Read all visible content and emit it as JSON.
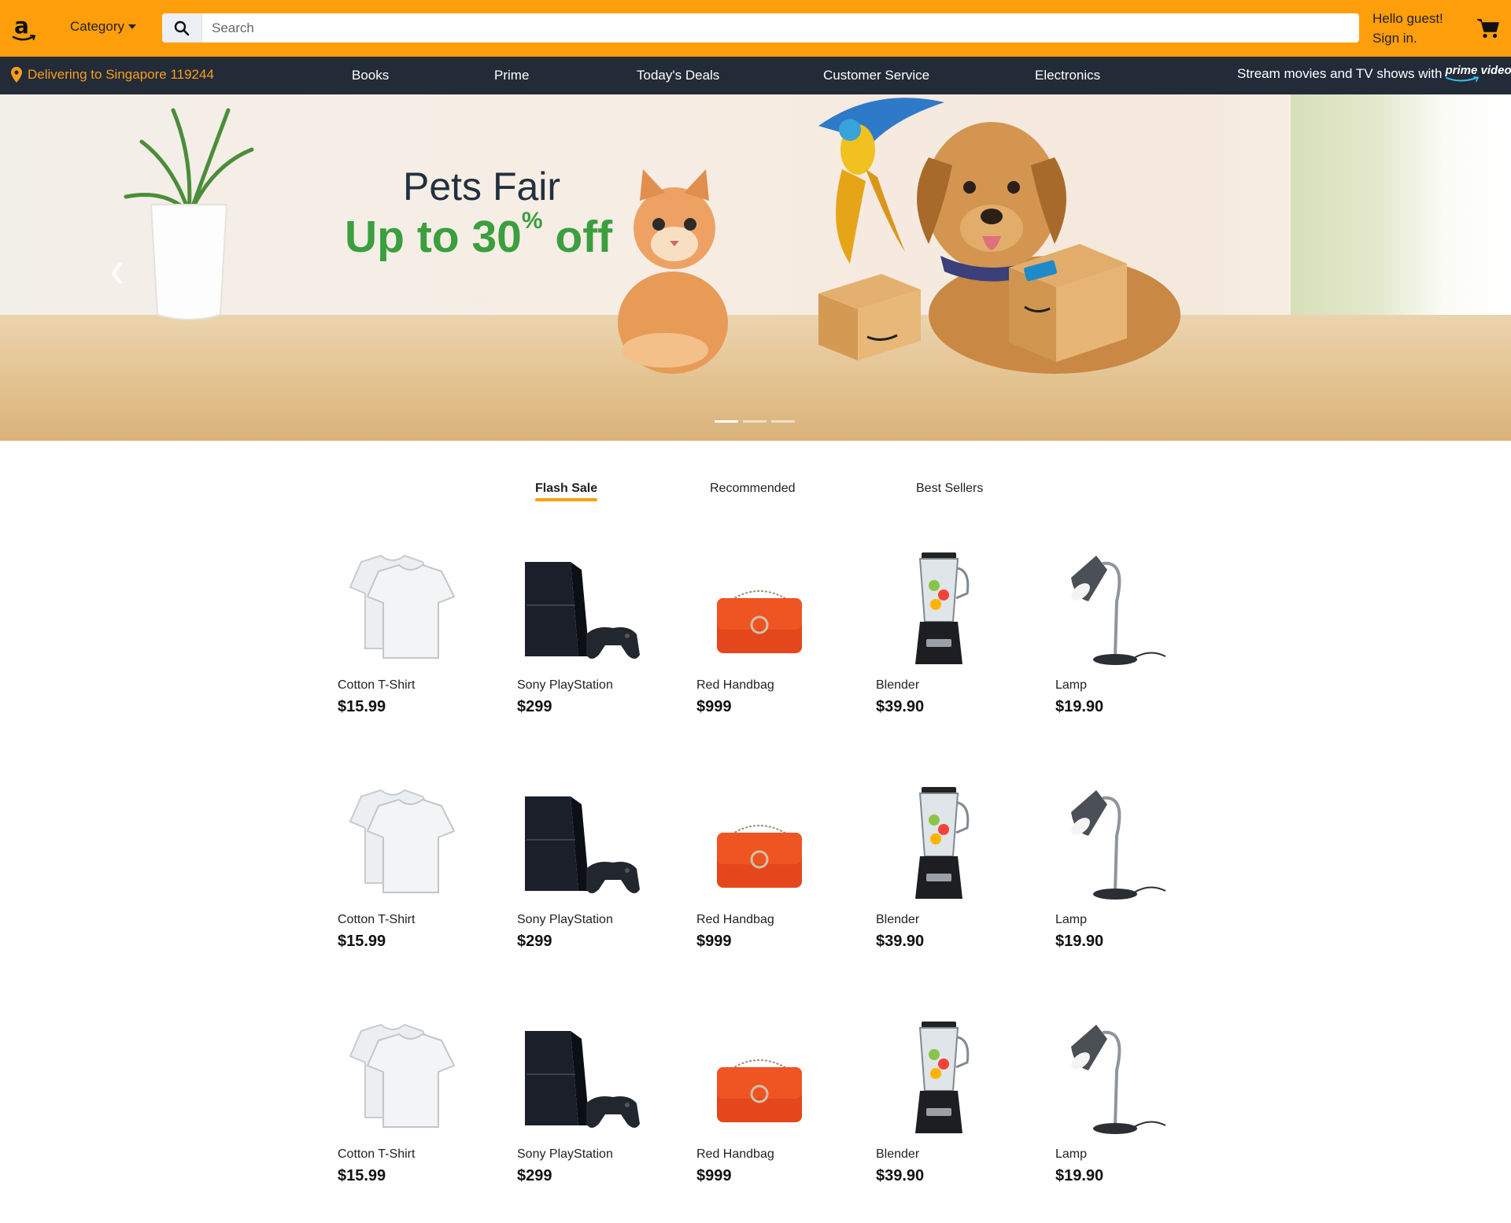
{
  "header": {
    "category_label": "Category",
    "search_placeholder": "Search",
    "greeting_line1": "Hello guest!",
    "greeting_line2": "Sign in."
  },
  "nav": {
    "delivery": "Delivering to Singapore 119244",
    "links": [
      "Books",
      "Prime",
      "Today's Deals",
      "Customer Service",
      "Electronics"
    ],
    "stream_text": "Stream movies and TV shows with",
    "prime_video_label": "prime video"
  },
  "hero": {
    "title": "Pets Fair",
    "subtitle_prefix": "Up to 30",
    "subtitle_percent": "%",
    "subtitle_suffix": " off",
    "slides_count": 3,
    "active_slide": 1
  },
  "tabs": [
    "Flash Sale",
    "Recommended",
    "Best Sellers"
  ],
  "active_tab": "Flash Sale",
  "products": [
    {
      "name": "Cotton T-Shirt",
      "price": "$15.99",
      "icon": "tshirt-icon"
    },
    {
      "name": "Sony PlayStation",
      "price": "$299",
      "icon": "playstation-icon"
    },
    {
      "name": "Red Handbag",
      "price": "$999",
      "icon": "handbag-icon"
    },
    {
      "name": "Blender",
      "price": "$39.90",
      "icon": "blender-icon"
    },
    {
      "name": "Lamp",
      "price": "$19.90",
      "icon": "lamp-icon"
    },
    {
      "name": "Cotton T-Shirt",
      "price": "$15.99",
      "icon": "tshirt-icon"
    },
    {
      "name": "Sony PlayStation",
      "price": "$299",
      "icon": "playstation-icon"
    },
    {
      "name": "Red Handbag",
      "price": "$999",
      "icon": "handbag-icon"
    },
    {
      "name": "Blender",
      "price": "$39.90",
      "icon": "blender-icon"
    },
    {
      "name": "Lamp",
      "price": "$19.90",
      "icon": "lamp-icon"
    },
    {
      "name": "Cotton T-Shirt",
      "price": "$15.99",
      "icon": "tshirt-icon"
    },
    {
      "name": "Sony PlayStation",
      "price": "$299",
      "icon": "playstation-icon"
    },
    {
      "name": "Red Handbag",
      "price": "$999",
      "icon": "handbag-icon"
    },
    {
      "name": "Blender",
      "price": "$39.90",
      "icon": "blender-icon"
    },
    {
      "name": "Lamp",
      "price": "$19.90",
      "icon": "lamp-icon"
    }
  ],
  "colors": {
    "header_bg": "#ff9e0b",
    "nav_bg": "#232a38",
    "delivery_text": "#f6a01a",
    "hero_green": "#3b9e3f",
    "tab_underline": "#ff9e0b"
  }
}
